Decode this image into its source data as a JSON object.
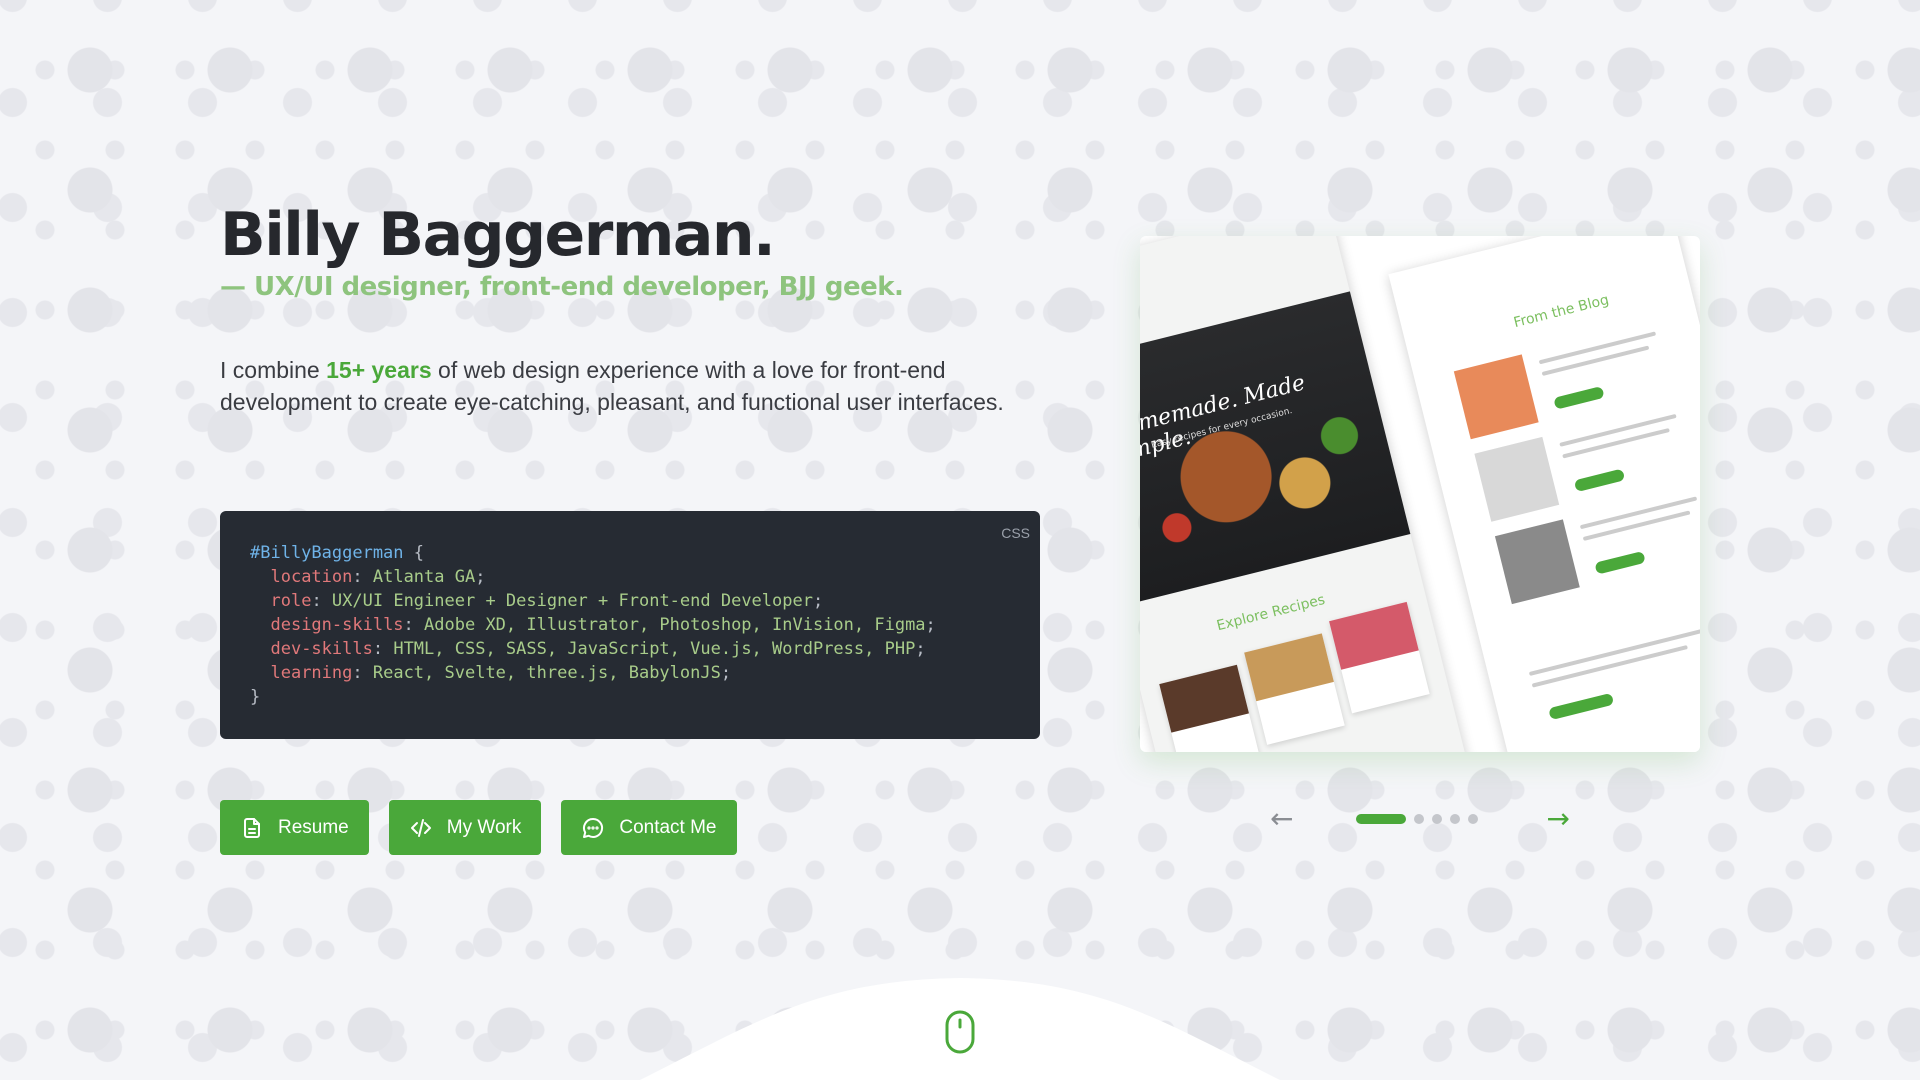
{
  "hero": {
    "name": "Billy Baggerman.",
    "tagline": "— UX/UI designer, front-end developer, BJJ geek.",
    "intro_before": "I combine ",
    "intro_highlight": "15+ years",
    "intro_after": " of web design experience with a love for front-end development to create eye-catching, pleasant, and functional user interfaces."
  },
  "code": {
    "language": "CSS",
    "selector": "#BillyBaggerman",
    "open_brace": " {",
    "close_brace": "}",
    "lines": [
      {
        "prop": "location",
        "value": "Atlanta GA"
      },
      {
        "prop": "role",
        "value": "UX/UI Engineer + Designer + Front-end Developer"
      },
      {
        "prop": "design-skills",
        "value": "Adobe XD, Illustrator, Photoshop, InVision, Figma"
      },
      {
        "prop": "dev-skills",
        "value": "HTML, CSS, SASS, JavaScript, Vue.js, WordPress, PHP"
      },
      {
        "prop": "learning",
        "value": "React, Svelte, three.js, BabylonJS"
      }
    ]
  },
  "buttons": {
    "resume": "Resume",
    "my_work": "My Work",
    "contact": "Contact Me"
  },
  "carousel": {
    "slide_title": "Homemade. Made simple.",
    "slide_subtitle": "Easy recipes for every occasion.",
    "explore": "Explore Recipes",
    "blog": "From the Blog",
    "dots": 5,
    "active_dot": 0
  },
  "colors": {
    "accent": "#4aa83a",
    "tagline": "#8ec47e",
    "code_bg": "#262b33"
  },
  "icons": {
    "resume": "document-icon",
    "my_work": "code-icon",
    "contact": "chat-bubble-icon",
    "prev": "arrow-left-icon",
    "next": "arrow-right-icon",
    "scroll": "mouse-icon"
  }
}
